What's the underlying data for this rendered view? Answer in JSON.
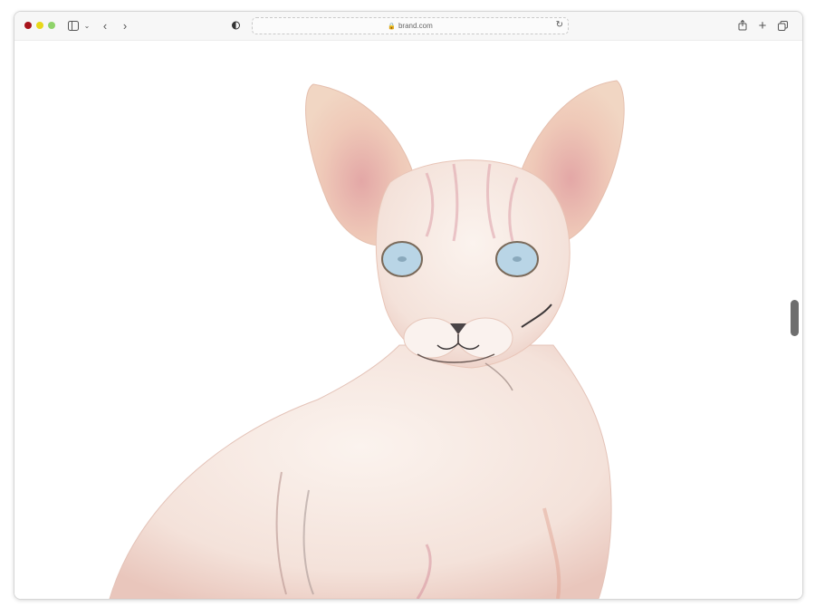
{
  "browser": {
    "url": "brand.com",
    "traffic_lights": {
      "close": "#a8141b",
      "minimize": "#e8d81a",
      "zoom": "#8fd36a"
    },
    "icons": [
      "sidebar-icon",
      "chevron-down-icon",
      "back-icon",
      "forward-icon",
      "privacy-shield-icon",
      "lock-icon",
      "reload-icon",
      "share-icon",
      "new-tab-icon",
      "tabs-overview-icon"
    ]
  },
  "page": {
    "image_subject": "colored pencil drawing of a sphynx cat"
  }
}
